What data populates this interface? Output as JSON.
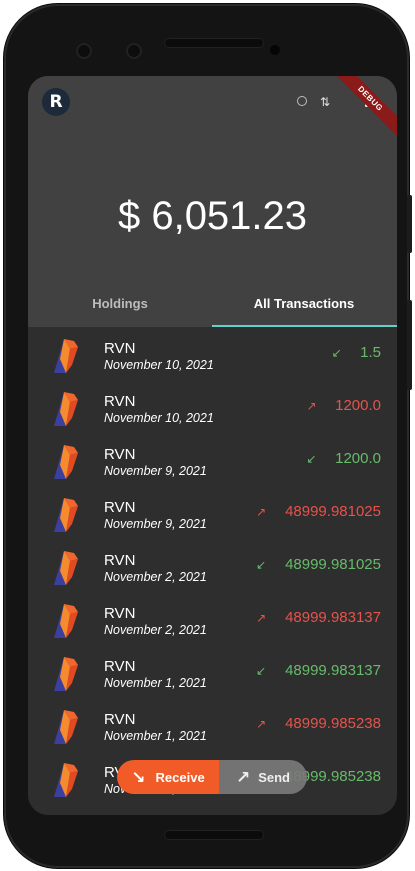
{
  "app": {
    "logo_letter": "R",
    "debug_label": "DEBUG",
    "balance": "$ 6,051.23"
  },
  "tabs": [
    {
      "label": "Holdings",
      "active": false
    },
    {
      "label": "All Transactions",
      "active": true
    }
  ],
  "colors": {
    "incoming": "#67bb6a",
    "outgoing": "#e5534b",
    "accent_tab": "#5fd3c9",
    "receive_button": "#f05b28"
  },
  "transactions": [
    {
      "asset": "RVN",
      "date": "November 10, 2021",
      "direction": "in",
      "icon": "arrow-in-icon",
      "amount": "1.5"
    },
    {
      "asset": "RVN",
      "date": "November 10, 2021",
      "direction": "out",
      "icon": "arrow-out-icon",
      "amount": "1200.0"
    },
    {
      "asset": "RVN",
      "date": "November 9, 2021",
      "direction": "in",
      "icon": "arrow-in-icon",
      "amount": "1200.0"
    },
    {
      "asset": "RVN",
      "date": "November 9, 2021",
      "direction": "out",
      "icon": "arrow-out-icon",
      "amount": "48999.981025"
    },
    {
      "asset": "RVN",
      "date": "November 2, 2021",
      "direction": "in",
      "icon": "arrow-in-icon",
      "amount": "48999.981025"
    },
    {
      "asset": "RVN",
      "date": "November 2, 2021",
      "direction": "out",
      "icon": "arrow-out-icon",
      "amount": "48999.983137"
    },
    {
      "asset": "RVN",
      "date": "November 1, 2021",
      "direction": "in",
      "icon": "arrow-in-icon",
      "amount": "48999.983137"
    },
    {
      "asset": "RVN",
      "date": "November 1, 2021",
      "direction": "out",
      "icon": "arrow-out-icon",
      "amount": "48999.985238"
    },
    {
      "asset": "RVN",
      "date": "November 1, 2021",
      "direction": "in",
      "icon": "arrow-in-icon",
      "amount": "48999.985238"
    }
  ],
  "actions": {
    "receive_label": "Receive",
    "send_label": "Send"
  }
}
